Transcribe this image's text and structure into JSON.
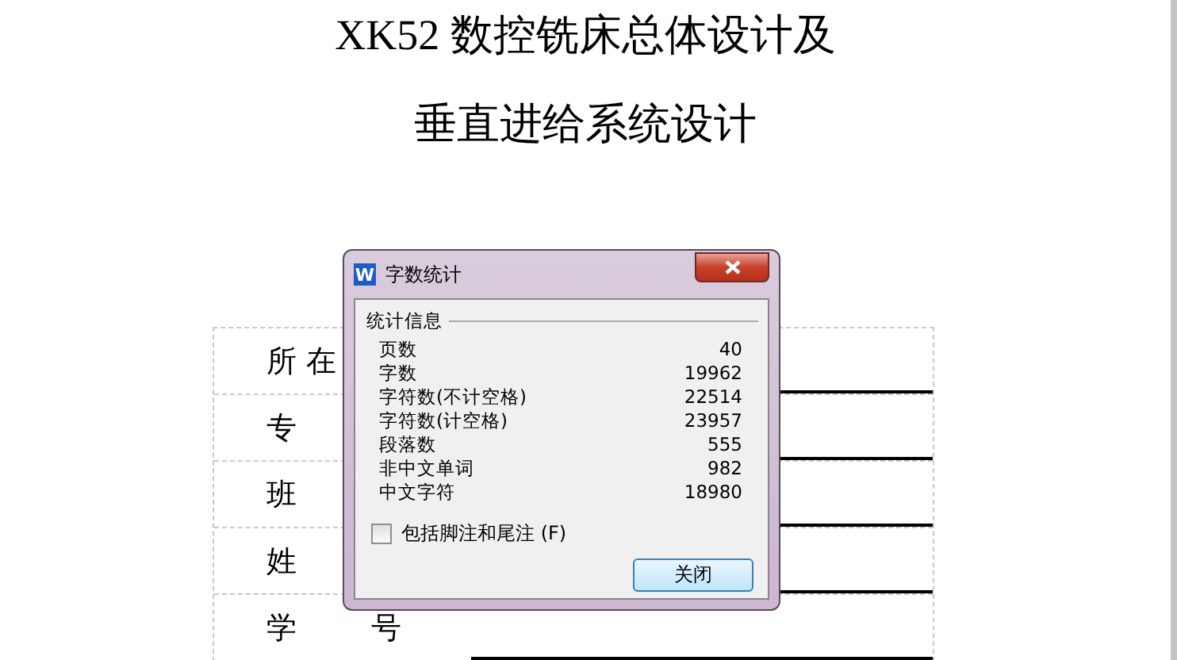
{
  "document": {
    "title_lines": [
      "XK52 数控铣床总体设计及",
      "垂直进给系统设计"
    ],
    "form_rows": [
      {
        "labels": [
          "所 在"
        ]
      },
      {
        "labels": [
          "专"
        ]
      },
      {
        "labels": [
          "班"
        ]
      },
      {
        "labels": [
          "姓"
        ]
      },
      {
        "labels": [
          "学",
          "号"
        ]
      }
    ]
  },
  "dialog": {
    "icon_text": "W",
    "title": "字数统计",
    "group_title": "统计信息",
    "stats": [
      {
        "label": "页数",
        "value": "40"
      },
      {
        "label": "字数",
        "value": "19962"
      },
      {
        "label": "字符数(不计空格)",
        "value": "22514"
      },
      {
        "label": "字符数(计空格)",
        "value": "23957"
      },
      {
        "label": "段落数",
        "value": "555"
      },
      {
        "label": "非中文单词",
        "value": "982"
      },
      {
        "label": "中文字符",
        "value": "18980"
      }
    ],
    "checkbox": {
      "label": "包括脚注和尾注 (F)",
      "checked": false
    },
    "button": "关闭"
  }
}
